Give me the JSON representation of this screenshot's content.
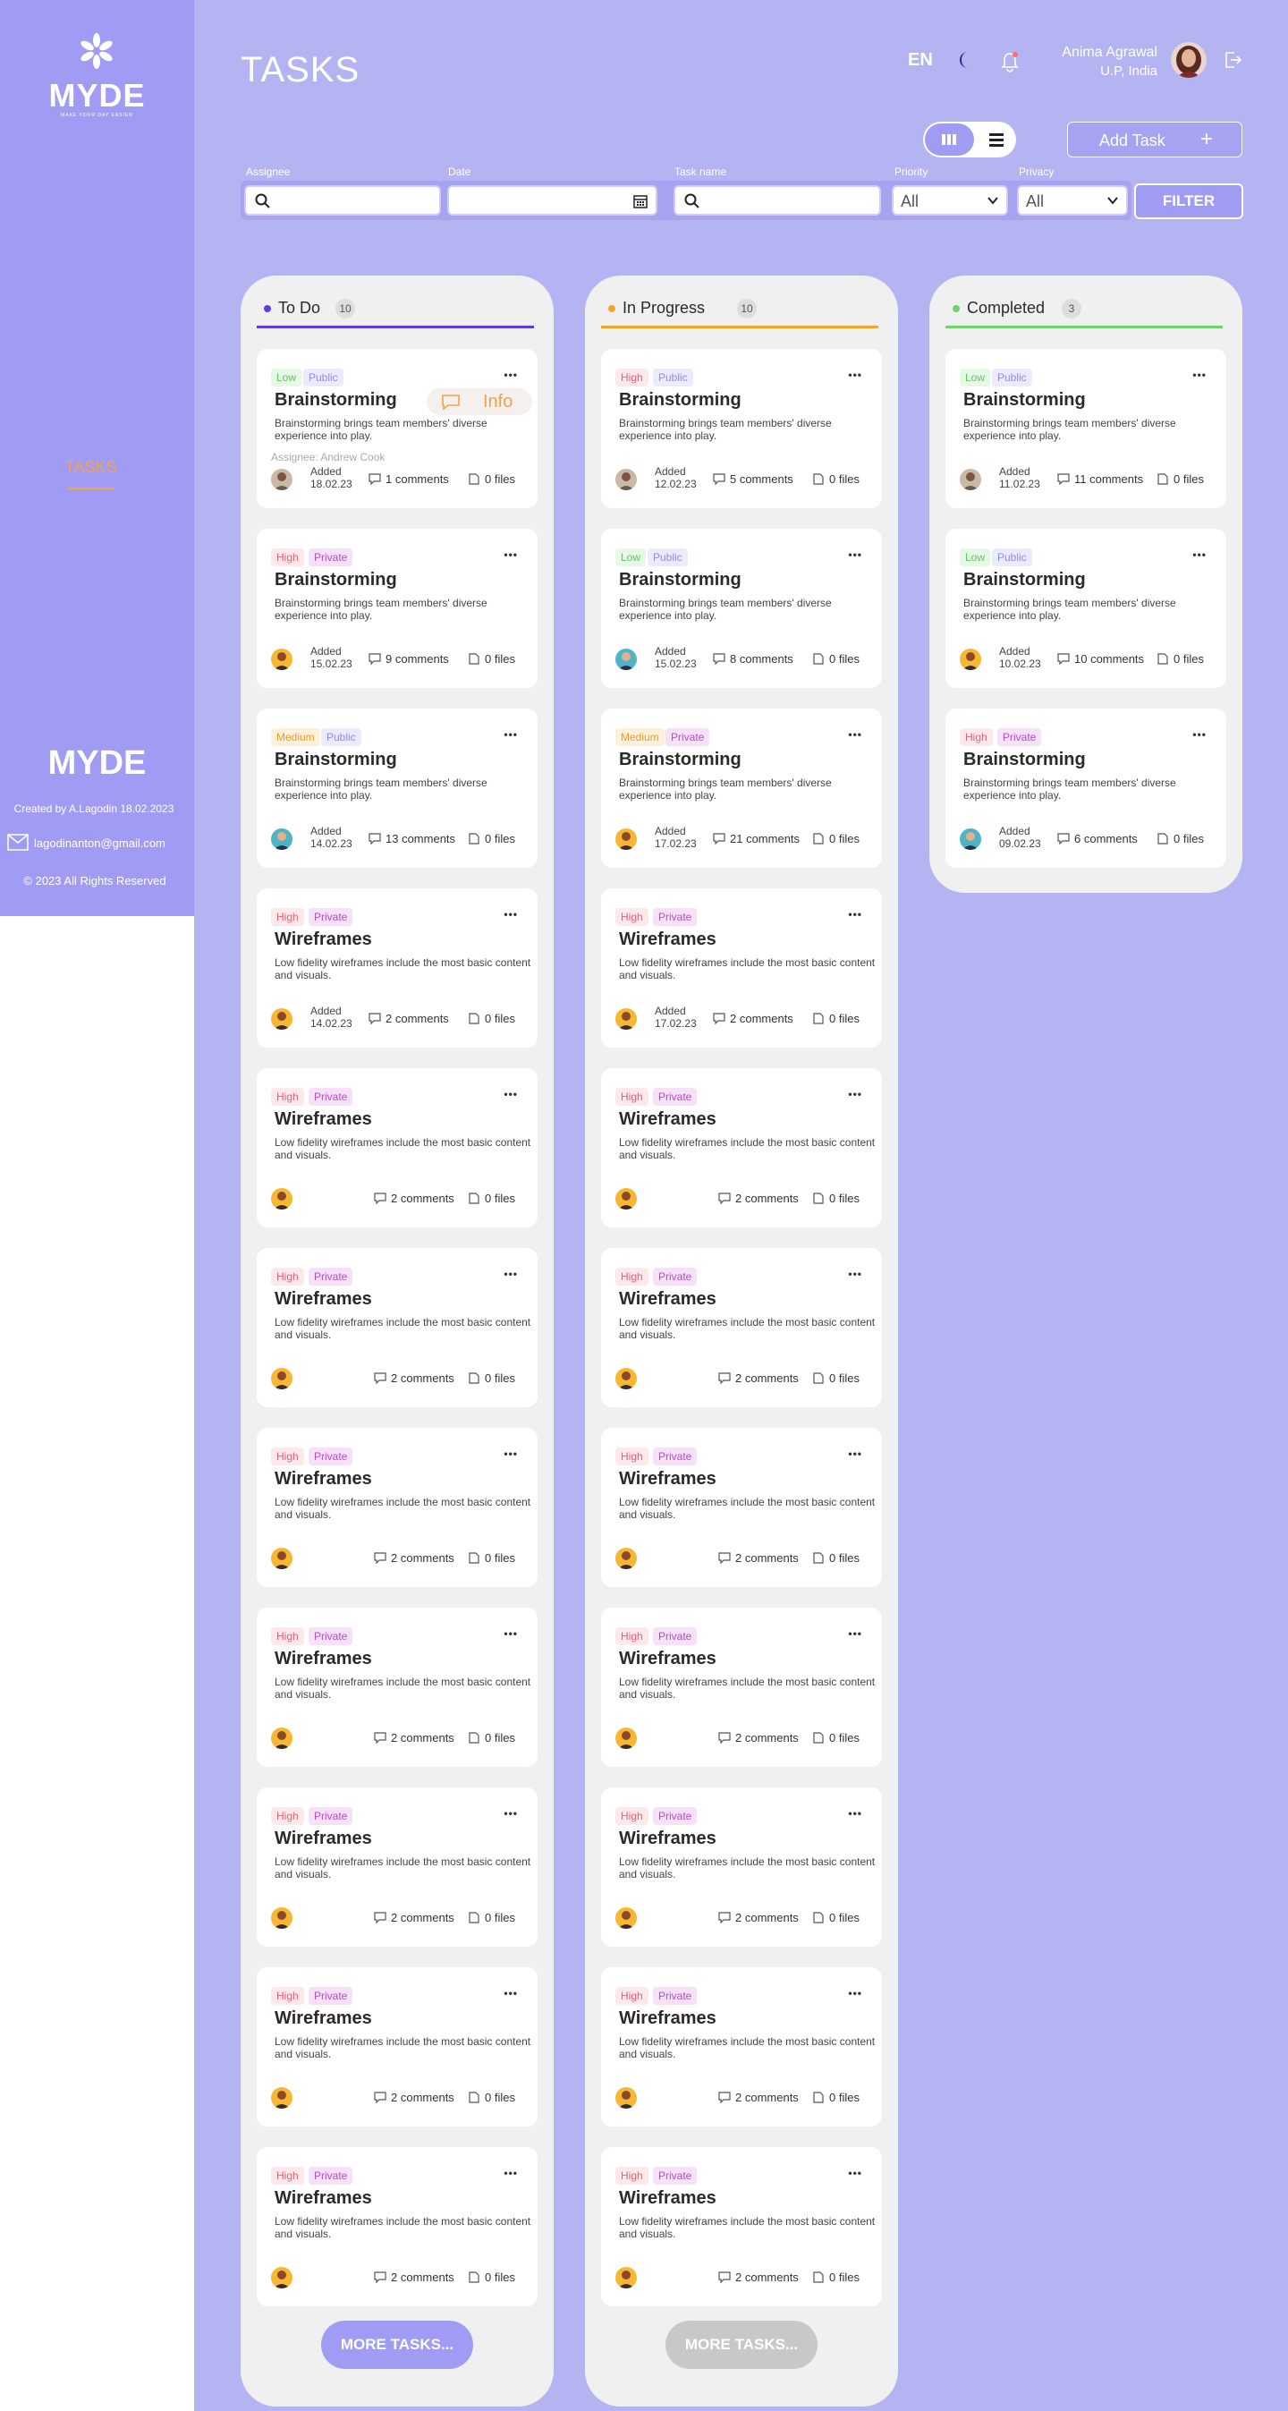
{
  "sidebar": {
    "logo": "MYDE",
    "logo_sub": "MAKE YOUR DAY EASIER",
    "nav": [
      {
        "label": "TASKS",
        "active": true
      }
    ],
    "brand": "MYDE",
    "created": "Created by A.Lagodin 18.02.2023",
    "email": "lagodinanton@gmail.com",
    "copyright": "© 2023 All Rights Reserved"
  },
  "header": {
    "title": "TASKS",
    "lang": "EN",
    "user_name": "Anima Agrawal",
    "user_location": "U.P, India",
    "add_task": "Add Task"
  },
  "filters": {
    "assignee_label": "Assignee",
    "date_label": "Date",
    "taskname_label": "Task name",
    "priority_label": "Priority",
    "privacy_label": "Privacy",
    "priority_value": "All",
    "privacy_value": "All",
    "filter_button": "FILTER"
  },
  "colors": {
    "todo": "#5b3be8",
    "progress": "#f7a32b",
    "completed": "#6fd46a",
    "accent": "#a19cf3",
    "high": "#e2607b",
    "low": "#5cc85a",
    "medium": "#e89c32",
    "public": "#8f8ce8",
    "private": "#b14fc4"
  },
  "columns": [
    {
      "title": "To Do",
      "count": "10",
      "more": "MORE TASKS...",
      "cards": [
        {
          "priority": "Low",
          "privacy": "Public",
          "title": "Brainstorming",
          "desc": "Brainstorming brings team members' diverse experience into play.",
          "assignee": "Assignee: Andrew Cook",
          "added": "Added",
          "date": "18.02.23",
          "comments": "1 comments",
          "files": "0 files",
          "info": "Info",
          "avatar": "man"
        },
        {
          "priority": "High",
          "privacy": "Private",
          "title": "Brainstorming",
          "desc": "Brainstorming brings team members' diverse experience into play.",
          "added": "Added",
          "date": "15.02.23",
          "comments": "9 comments",
          "files": "0 files",
          "avatar": "yellow"
        },
        {
          "priority": "Medium",
          "privacy": "Public",
          "title": "Brainstorming",
          "desc": "Brainstorming brings team members' diverse experience into play.",
          "added": "Added",
          "date": "14.02.23",
          "comments": "13 comments",
          "files": "0 files",
          "avatar": "teal"
        },
        {
          "priority": "High",
          "privacy": "Private",
          "title": "Wireframes",
          "desc": "Low fidelity wireframes include the most basic content and visuals.",
          "added": "Added",
          "date": "14.02.23",
          "comments": "2 comments",
          "files": "0 files",
          "avatar": "yellow"
        },
        {
          "priority": "High",
          "privacy": "Private",
          "title": "Wireframes",
          "desc": "Low fidelity wireframes include the most basic content and visuals.",
          "comments": "2 comments",
          "files": "0 files",
          "avatar": "yellow"
        },
        {
          "priority": "High",
          "privacy": "Private",
          "title": "Wireframes",
          "desc": "Low fidelity wireframes include the most basic content and visuals.",
          "comments": "2 comments",
          "files": "0 files",
          "avatar": "yellow"
        },
        {
          "priority": "High",
          "privacy": "Private",
          "title": "Wireframes",
          "desc": "Low fidelity wireframes include the most basic content and visuals.",
          "comments": "2 comments",
          "files": "0 files",
          "avatar": "yellow"
        },
        {
          "priority": "High",
          "privacy": "Private",
          "title": "Wireframes",
          "desc": "Low fidelity wireframes include the most basic content and visuals.",
          "comments": "2 comments",
          "files": "0 files",
          "avatar": "yellow"
        },
        {
          "priority": "High",
          "privacy": "Private",
          "title": "Wireframes",
          "desc": "Low fidelity wireframes include the most basic content and visuals.",
          "comments": "2 comments",
          "files": "0 files",
          "avatar": "yellow"
        },
        {
          "priority": "High",
          "privacy": "Private",
          "title": "Wireframes",
          "desc": "Low fidelity wireframes include the most basic content and visuals.",
          "comments": "2 comments",
          "files": "0 files",
          "avatar": "yellow"
        },
        {
          "priority": "High",
          "privacy": "Private",
          "title": "Wireframes",
          "desc": "Low fidelity wireframes include the most basic content and visuals.",
          "comments": "2 comments",
          "files": "0 files",
          "avatar": "yellow"
        }
      ]
    },
    {
      "title": "In Progress",
      "count": "10",
      "more": "MORE TASKS...",
      "cards": [
        {
          "priority": "High",
          "privacy": "Public",
          "title": "Brainstorming",
          "desc": "Brainstorming brings team members' diverse experience into play.",
          "added": "Added",
          "date": "12.02.23",
          "comments": "5 comments",
          "files": "0 files",
          "avatar": "man"
        },
        {
          "priority": "Low",
          "privacy": "Public",
          "title": "Brainstorming",
          "desc": "Brainstorming brings team members' diverse experience into play.",
          "added": "Added",
          "date": "15.02.23",
          "comments": "8 comments",
          "files": "0 files",
          "avatar": "teal"
        },
        {
          "priority": "Medium",
          "privacy": "Private",
          "title": "Brainstorming",
          "desc": "Brainstorming brings team members' diverse experience into play.",
          "added": "Added",
          "date": "17.02.23",
          "comments": "21 comments",
          "files": "0 files",
          "avatar": "yellow"
        },
        {
          "priority": "High",
          "privacy": "Private",
          "title": "Wireframes",
          "desc": "Low fidelity wireframes include the most basic content and visuals.",
          "added": "Added",
          "date": "17.02.23",
          "comments": "2 comments",
          "files": "0 files",
          "avatar": "yellow"
        },
        {
          "priority": "High",
          "privacy": "Private",
          "title": "Wireframes",
          "desc": "Low fidelity wireframes include the most basic content and visuals.",
          "comments": "2 comments",
          "files": "0 files",
          "avatar": "yellow"
        },
        {
          "priority": "High",
          "privacy": "Private",
          "title": "Wireframes",
          "desc": "Low fidelity wireframes include the most basic content and visuals.",
          "comments": "2 comments",
          "files": "0 files",
          "avatar": "yellow"
        },
        {
          "priority": "High",
          "privacy": "Private",
          "title": "Wireframes",
          "desc": "Low fidelity wireframes include the most basic content and visuals.",
          "comments": "2 comments",
          "files": "0 files",
          "avatar": "yellow"
        },
        {
          "priority": "High",
          "privacy": "Private",
          "title": "Wireframes",
          "desc": "Low fidelity wireframes include the most basic content and visuals.",
          "comments": "2 comments",
          "files": "0 files",
          "avatar": "yellow"
        },
        {
          "priority": "High",
          "privacy": "Private",
          "title": "Wireframes",
          "desc": "Low fidelity wireframes include the most basic content and visuals.",
          "comments": "2 comments",
          "files": "0 files",
          "avatar": "yellow"
        },
        {
          "priority": "High",
          "privacy": "Private",
          "title": "Wireframes",
          "desc": "Low fidelity wireframes include the most basic content and visuals.",
          "comments": "2 comments",
          "files": "0 files",
          "avatar": "yellow"
        },
        {
          "priority": "High",
          "privacy": "Private",
          "title": "Wireframes",
          "desc": "Low fidelity wireframes include the most basic content and visuals.",
          "comments": "2 comments",
          "files": "0 files",
          "avatar": "yellow"
        }
      ]
    },
    {
      "title": "Completed",
      "count": "3",
      "cards": [
        {
          "priority": "Low",
          "privacy": "Public",
          "title": "Brainstorming",
          "desc": "Brainstorming brings team members' diverse experience into play.",
          "added": "Added",
          "date": "11.02.23",
          "comments": "11 comments",
          "files": "0 files",
          "avatar": "man"
        },
        {
          "priority": "Low",
          "privacy": "Public",
          "title": "Brainstorming",
          "desc": "Brainstorming brings team members' diverse experience into play.",
          "added": "Added",
          "date": "10.02.23",
          "comments": "10 comments",
          "files": "0 files",
          "avatar": "yellow"
        },
        {
          "priority": "High",
          "privacy": "Private",
          "title": "Brainstorming",
          "desc": "Brainstorming brings team members' diverse experience into play.",
          "added": "Added",
          "date": "09.02.23",
          "comments": "6 comments",
          "files": "0 files",
          "avatar": "teal"
        }
      ]
    }
  ]
}
